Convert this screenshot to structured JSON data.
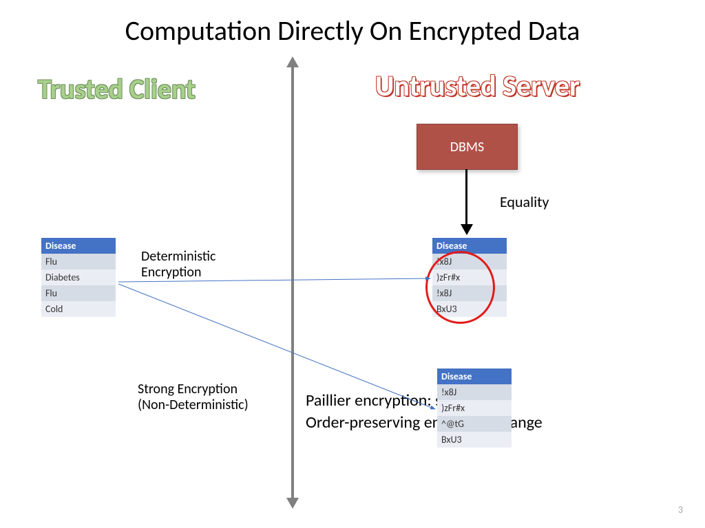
{
  "slide": {
    "title": "Computation Directly On Encrypted Data",
    "page_number": "3"
  },
  "headings": {
    "trusted": "Trusted Client",
    "untrusted": "Untrusted Server"
  },
  "dbms_label": "DBMS",
  "labels": {
    "equality": "Equality",
    "det_line1": "Deterministic",
    "det_line2": "Encryption",
    "strong_line1": "Strong Encryption",
    "strong_line2": "(Non-Deterministic)",
    "paillier": "Paillier encryption: summation",
    "order": "Order-preserving encryption: range"
  },
  "table_client": {
    "header": "Disease",
    "rows": [
      "Flu",
      "Diabetes",
      "Flu",
      "Cold"
    ]
  },
  "table_enc_top": {
    "header": "Disease",
    "rows": [
      "!x8J",
      ")zFr#x",
      "!x8J",
      "BxU3"
    ]
  },
  "table_enc_bottom": {
    "header": "Disease",
    "rows": [
      "!x8J",
      ")zFr#x",
      "^@tG",
      "BxU3"
    ]
  }
}
